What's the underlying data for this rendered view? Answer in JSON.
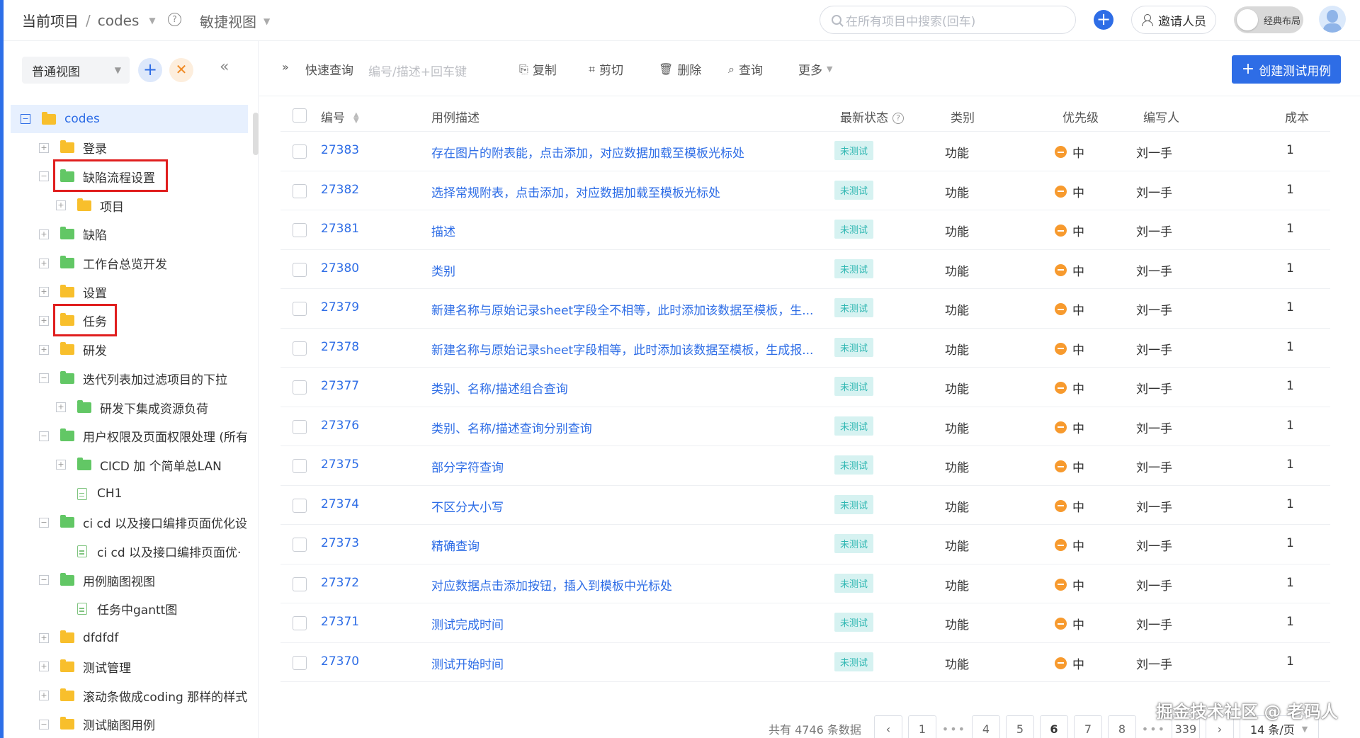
{
  "header": {
    "crumb_current": "当前项目",
    "crumb_sep": "/",
    "crumb_project": "codes",
    "help_glyph": "?",
    "view_mode": "敏捷视图",
    "search_placeholder": "在所有项目中搜索(回车)",
    "invite_label": "邀请人员",
    "classic_layout_label": "经典布局"
  },
  "sidebar": {
    "view_select": "普通视图",
    "tree": [
      {
        "label": "codes",
        "level": 0,
        "icon": "folder-yellow",
        "expander": "−",
        "root": true
      },
      {
        "label": "登录",
        "level": 1,
        "icon": "folder-yellow",
        "expander": "+"
      },
      {
        "label": "缺陷流程设置",
        "level": 1,
        "icon": "folder-green",
        "expander": "−",
        "highlight": true
      },
      {
        "label": "项目",
        "level": 2,
        "icon": "folder-yellow",
        "expander": "+"
      },
      {
        "label": "缺陷",
        "level": 1,
        "icon": "folder-green",
        "expander": "+"
      },
      {
        "label": "工作台总览开发",
        "level": 1,
        "icon": "folder-green",
        "expander": "+"
      },
      {
        "label": "设置",
        "level": 1,
        "icon": "folder-yellow",
        "expander": "+"
      },
      {
        "label": "任务",
        "level": 1,
        "icon": "folder-yellow",
        "expander": "+",
        "highlight": true
      },
      {
        "label": "研发",
        "level": 1,
        "icon": "folder-yellow",
        "expander": "+"
      },
      {
        "label": "迭代列表加过滤项目的下拉",
        "level": 1,
        "icon": "folder-green",
        "expander": "−"
      },
      {
        "label": "研发下集成资源负荷",
        "level": 2,
        "icon": "folder-green",
        "expander": "+"
      },
      {
        "label": "用户权限及页面权限处理 (所有",
        "level": 1,
        "icon": "folder-green",
        "expander": "−"
      },
      {
        "label": "CICD 加 个简单总LAN",
        "level": 2,
        "icon": "folder-green",
        "expander": "+"
      },
      {
        "label": "CH1",
        "level": 2,
        "icon": "file",
        "expander": ""
      },
      {
        "label": "ci cd 以及接口编排页面优化设",
        "level": 1,
        "icon": "folder-green",
        "expander": "−"
      },
      {
        "label": "ci cd 以及接口编排页面优·",
        "level": 2,
        "icon": "file",
        "expander": ""
      },
      {
        "label": "用例脑图视图",
        "level": 1,
        "icon": "folder-green",
        "expander": "−"
      },
      {
        "label": "任务中gantt图",
        "level": 2,
        "icon": "file",
        "expander": ""
      },
      {
        "label": "dfdfdf",
        "level": 1,
        "icon": "folder-yellow",
        "expander": "+"
      },
      {
        "label": "测试管理",
        "level": 1,
        "icon": "folder-yellow",
        "expander": "+"
      },
      {
        "label": "滚动条做成coding 那样的样式",
        "level": 1,
        "icon": "folder-yellow",
        "expander": "+"
      },
      {
        "label": "测试脑图用例",
        "level": 1,
        "icon": "folder-yellow",
        "expander": "−"
      }
    ]
  },
  "toolbar": {
    "quick_query": "快速查询",
    "placeholder": "编号/描述+回车键",
    "copy": "复制",
    "cut": "剪切",
    "delete": "删除",
    "query": "查询",
    "more": "更多",
    "create": "创建测试用例"
  },
  "table": {
    "headers": {
      "id": "编号",
      "desc": "用例描述",
      "status": "最新状态",
      "type": "类别",
      "priority": "优先级",
      "author": "编写人",
      "cost": "成本"
    },
    "rows": [
      {
        "id": "27383",
        "desc": "存在图片的附表能，点击添加，对应数据加载至模板光标处",
        "status": "未测试",
        "type": "功能",
        "priority": "中",
        "author": "刘一手",
        "cost": "1"
      },
      {
        "id": "27382",
        "desc": "选择常规附表，点击添加，对应数据加载至模板光标处",
        "status": "未测试",
        "type": "功能",
        "priority": "中",
        "author": "刘一手",
        "cost": "1"
      },
      {
        "id": "27381",
        "desc": "描述",
        "status": "未测试",
        "type": "功能",
        "priority": "中",
        "author": "刘一手",
        "cost": "1"
      },
      {
        "id": "27380",
        "desc": "类别",
        "status": "未测试",
        "type": "功能",
        "priority": "中",
        "author": "刘一手",
        "cost": "1"
      },
      {
        "id": "27379",
        "desc": "新建名称与原始记录sheet字段全不相等，此时添加该数据至模板，生...",
        "status": "未测试",
        "type": "功能",
        "priority": "中",
        "author": "刘一手",
        "cost": "1"
      },
      {
        "id": "27378",
        "desc": "新建名称与原始记录sheet字段相等，此时添加该数据至模板，生成报...",
        "status": "未测试",
        "type": "功能",
        "priority": "中",
        "author": "刘一手",
        "cost": "1"
      },
      {
        "id": "27377",
        "desc": "类别、名称/描述组合查询",
        "status": "未测试",
        "type": "功能",
        "priority": "中",
        "author": "刘一手",
        "cost": "1"
      },
      {
        "id": "27376",
        "desc": "类别、名称/描述查询分别查询",
        "status": "未测试",
        "type": "功能",
        "priority": "中",
        "author": "刘一手",
        "cost": "1"
      },
      {
        "id": "27375",
        "desc": "部分字符查询",
        "status": "未测试",
        "type": "功能",
        "priority": "中",
        "author": "刘一手",
        "cost": "1"
      },
      {
        "id": "27374",
        "desc": "不区分大小写",
        "status": "未测试",
        "type": "功能",
        "priority": "中",
        "author": "刘一手",
        "cost": "1"
      },
      {
        "id": "27373",
        "desc": "精确查询",
        "status": "未测试",
        "type": "功能",
        "priority": "中",
        "author": "刘一手",
        "cost": "1"
      },
      {
        "id": "27372",
        "desc": "对应数据点击添加按钮，插入到模板中光标处",
        "status": "未测试",
        "type": "功能",
        "priority": "中",
        "author": "刘一手",
        "cost": "1"
      },
      {
        "id": "27371",
        "desc": "测试完成时间",
        "status": "未测试",
        "type": "功能",
        "priority": "中",
        "author": "刘一手",
        "cost": "1"
      },
      {
        "id": "27370",
        "desc": "测试开始时间",
        "status": "未测试",
        "type": "功能",
        "priority": "中",
        "author": "刘一手",
        "cost": "1"
      }
    ]
  },
  "pagination": {
    "total": "共有 4746 条数据",
    "pages": [
      "1",
      "•••",
      "4",
      "5",
      "6",
      "7",
      "8",
      "•••",
      "339"
    ],
    "current": "6",
    "page_size": "14 条/页"
  },
  "watermark": "掘金技术社区 @ 老码人",
  "colors": {
    "accent": "#2e6de6",
    "status_bg": "#d6f2f1",
    "status_text": "#2fb7b2",
    "priority_medium": "#f79a2e",
    "highlight_box": "#e01e1e"
  }
}
